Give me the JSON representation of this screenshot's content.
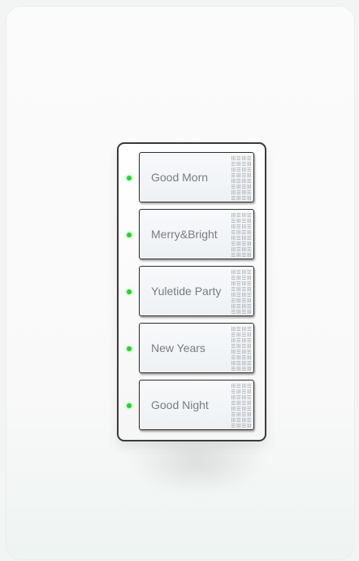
{
  "keypad": {
    "buttons": [
      {
        "label": "Good Morn",
        "led_color": "#22d62a"
      },
      {
        "label": "Merry&Bright",
        "led_color": "#22d62a"
      },
      {
        "label": "Yuletide Party",
        "led_color": "#22d62a"
      },
      {
        "label": "New Years",
        "led_color": "#22d62a"
      },
      {
        "label": "Good Night",
        "led_color": "#22d62a"
      }
    ],
    "texture_icon": "engraved-pattern-icon"
  },
  "colors": {
    "background": "#f9f9f9",
    "frame": "#3a3a3a",
    "button_face": "#f3f6f8",
    "label": "#7a7c80",
    "led": "#22d62a"
  }
}
